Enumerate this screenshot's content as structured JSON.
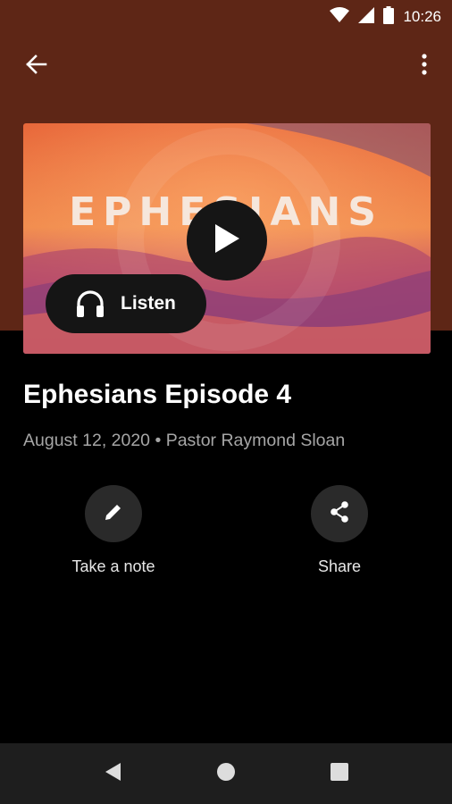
{
  "status_bar": {
    "time": "10:26"
  },
  "app_bar": {
    "back_icon": "arrow-left-icon",
    "more_icon": "more-vertical-icon"
  },
  "artwork": {
    "title": "EPHESIANS"
  },
  "player": {
    "play_icon": "play-icon",
    "listen_label": "Listen"
  },
  "episode": {
    "title": "Ephesians Episode 4",
    "meta": "August 12, 2020 • Pastor Raymond Sloan"
  },
  "actions": [
    {
      "label": "Take a note",
      "icon": "pencil-icon"
    },
    {
      "label": "Share",
      "icon": "share-icon"
    }
  ],
  "colors": {
    "header_bg": "#5e2616",
    "background": "#000000",
    "button_bg": "#151515",
    "action_circle": "#2a2a2a"
  }
}
